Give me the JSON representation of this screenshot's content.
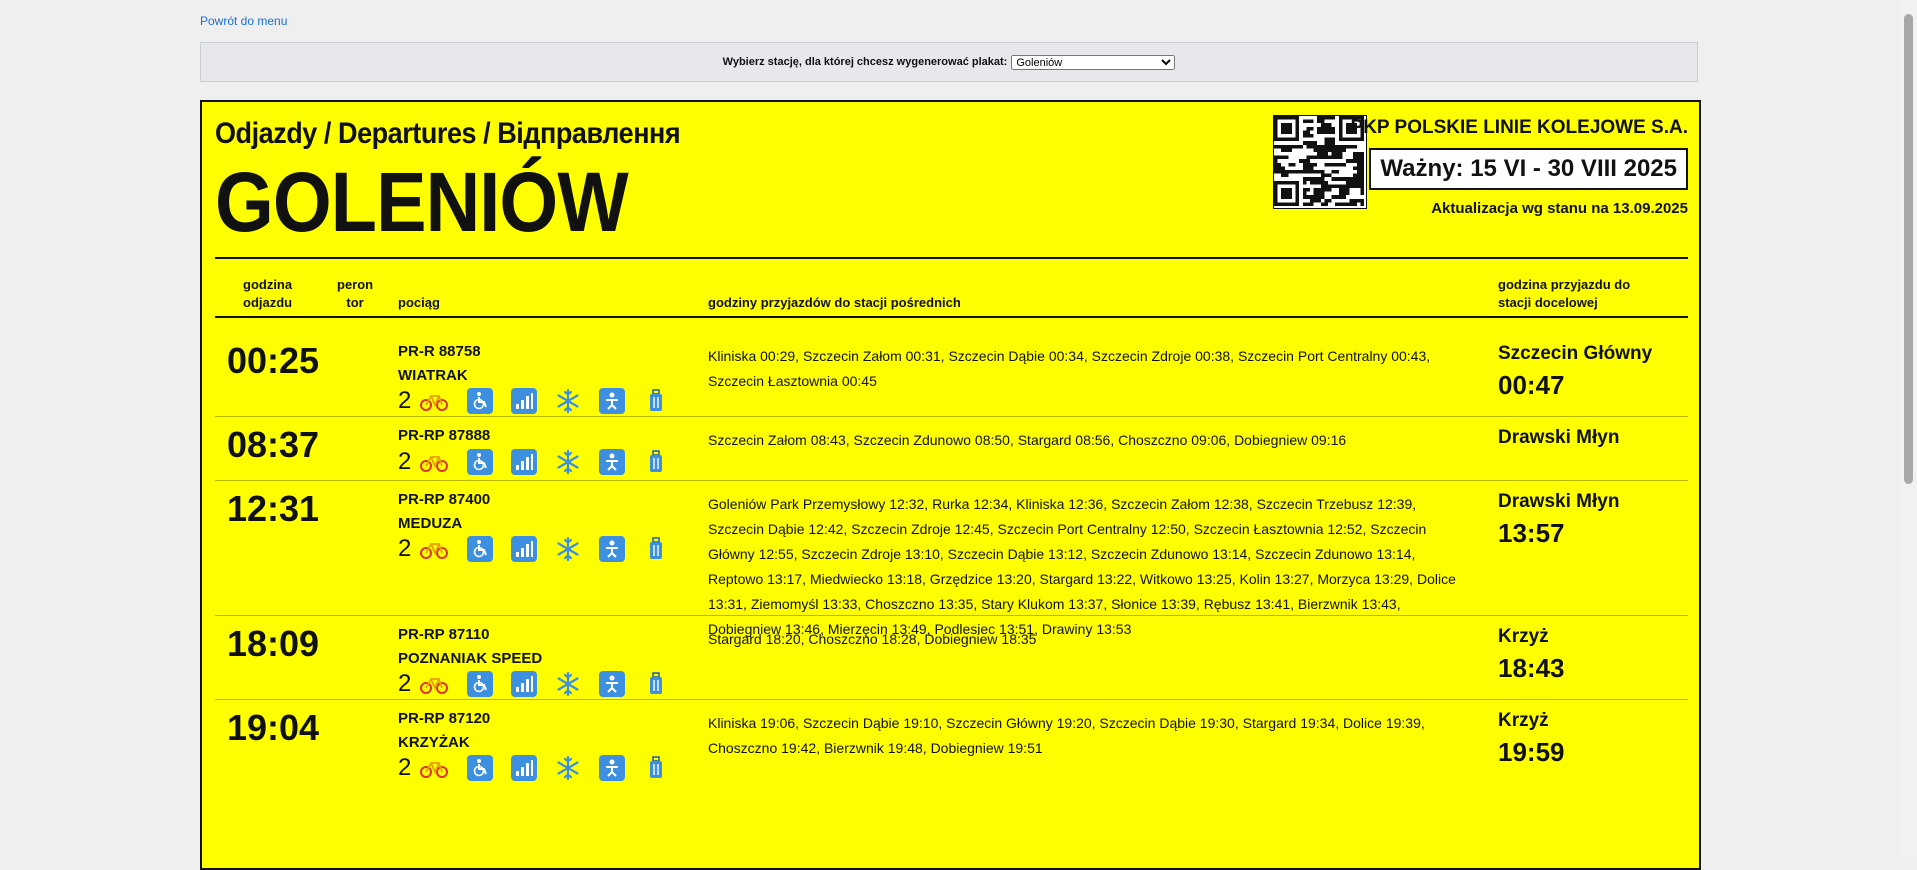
{
  "nav": {
    "back_label": "Powrót do menu"
  },
  "station_picker": {
    "label": "Wybierz stację, dla której chcesz wygenerować plakat:",
    "selected": "Goleniów"
  },
  "poster": {
    "heading": "Odjazdy / Departures / Відправлення",
    "station": "GOLENIÓW",
    "company": "PKP POLSKIE LINIE KOLEJOWE S.A.",
    "validity": "Ważny: 15 VI - 30 VIII 2025",
    "updated": "Aktualizacja wg stanu na 13.09.2025",
    "background_color": "#ffff00",
    "columns": {
      "departure": [
        "godzina",
        "odjazdu"
      ],
      "platform": [
        "peron",
        "tor"
      ],
      "train": "pociąg",
      "stops": "godziny przyjazdów do stacji pośrednich",
      "destination": [
        "godzina przyjazdu do",
        "stacji docelowej"
      ]
    },
    "rows": [
      {
        "departure": "00:25",
        "train_number": "PR-R 88758",
        "train_name": "WIATRAK",
        "class": "2",
        "stops": "Kliniska 00:29, Szczecin Załom 00:31, Szczecin Dąbie 00:34, Szczecin Zdroje 00:38, Szczecin Port Centralny 00:43, Szczecin Łasztownia 00:45",
        "destination": "Szczecin Główny",
        "arrival": "00:47"
      },
      {
        "departure": "08:37",
        "train_number": "PR-RP 87888",
        "train_name": "",
        "class": "2",
        "stops": "Szczecin Załom 08:43, Szczecin Zdunowo 08:50, Stargard 08:56, Choszczno 09:06, Dobiegniew 09:16",
        "destination": "Drawski Młyn",
        "arrival": ""
      },
      {
        "departure": "12:31",
        "train_number": "PR-RP 87400",
        "train_name": "MEDUZA",
        "class": "2",
        "stops": "Goleniów Park Przemysłowy 12:32, Rurka 12:34, Kliniska 12:36, Szczecin Załom 12:38, Szczecin Trzebusz 12:39, Szczecin Dąbie 12:42, Szczecin Zdroje 12:45, Szczecin Port Centralny 12:50, Szczecin Łasztownia 12:52, Szczecin Główny 12:55, Szczecin Zdroje 13:10, Szczecin Dąbie 13:12, Szczecin Zdunowo 13:14, Szczecin Zdunowo 13:14, Reptowo 13:17, Miedwiecko 13:18, Grzędzice 13:20, Stargard 13:22, Witkowo 13:25, Kolin 13:27, Morzyca 13:29, Dolice 13:31, Ziemomyśl 13:33, Choszczno 13:35, Stary Klukom 13:37, Słonice 13:39, Rębusz 13:41, Bierzwnik 13:43, Dobiegniew 13:46, Mierzęcin 13:49, Podlesiec 13:51, Drawiny 13:53",
        "destination": "Drawski Młyn",
        "arrival": "13:57"
      },
      {
        "departure": "18:09",
        "train_number": "PR-RP 87110",
        "train_name": "POZNANIAK SPEED",
        "class": "2",
        "stops": "Stargard 18:20, Choszczno 18:28, Dobiegniew 18:35",
        "destination": "Krzyż",
        "arrival": "18:43"
      },
      {
        "departure": "19:04",
        "train_number": "PR-RP 87120",
        "train_name": "KRZYŻAK",
        "class": "2",
        "stops": "Kliniska 19:06, Szczecin Dąbie 19:10, Szczecin Główny 19:20, Szczecin Dąbie 19:30, Stargard 19:34, Dolice 19:39, Choszczno 19:42, Bierzwnik 19:48, Dobiegniew 19:51",
        "destination": "Krzyż",
        "arrival": "19:59"
      }
    ],
    "service_icons": [
      "bicycle-icon",
      "wheelchair-icon",
      "wifi-icon",
      "air-conditioning-icon",
      "baby-changing-icon",
      "luggage-icon"
    ]
  }
}
